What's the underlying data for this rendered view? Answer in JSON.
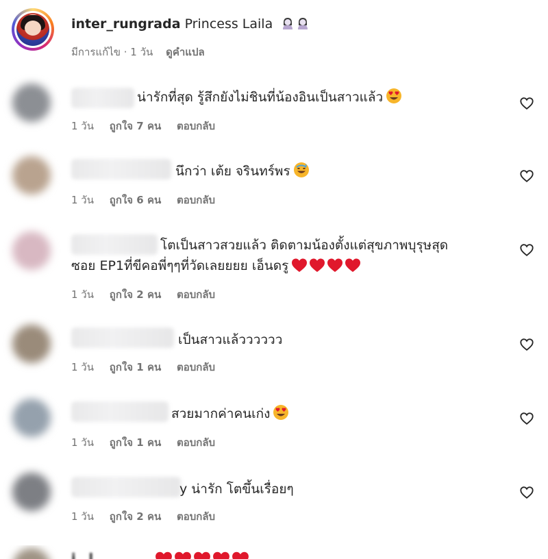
{
  "post": {
    "username": "inter_rungrada",
    "caption": "Princess Laila",
    "caption_emoji": [
      "woman-icon",
      "woman-icon"
    ],
    "meta_edited": "มีการแก้ไข · 1 วัน",
    "see_translation": "ดูคำแปล"
  },
  "comments": [
    {
      "text": "น่ารักที่สุด รู้สึกยังไม่ชินที่น้องอินเป็นสาวแล้ว",
      "emoji": [
        "heart-eyes-emoji"
      ],
      "time": "1 วัน",
      "likes": "ถูกใจ 7 คน",
      "reply": "ตอบกลับ",
      "avatar_color": "#8c8f94"
    },
    {
      "text": "นึกว่า เต้ย จรินทร์พร",
      "emoji": [
        "sweat-smile-emoji"
      ],
      "time": "1 วัน",
      "likes": "ถูกใจ 6 คน",
      "reply": "ตอบกลับ",
      "avatar_color": "#b9a38f"
    },
    {
      "text": "โตเป็นสาวสวยแล้ว ติดตามน้องตั้งแต่สุขภาพบุรุษสุด",
      "text2": "ซอย EP1ที่ขีคอพี่ๆๆที่วัดเลยยยย เอ็นดรู",
      "emoji": [
        "red-heart-emoji",
        "red-heart-emoji",
        "red-heart-emoji",
        "red-heart-emoji"
      ],
      "time": "1 วัน",
      "likes": "ถูกใจ 2 คน",
      "reply": "ตอบกลับ",
      "avatar_color": "#d8b8c2"
    },
    {
      "text": "เป็นสาวแล้วววววว",
      "emoji": [],
      "time": "1 วัน",
      "likes": "ถูกใจ 1 คน",
      "reply": "ตอบกลับ",
      "avatar_color": "#9a8b7a"
    },
    {
      "text": "สวยมากค่าคนเก่ง",
      "emoji": [
        "heart-eyes-emoji"
      ],
      "time": "1 วัน",
      "likes": "ถูกใจ 1 คน",
      "reply": "ตอบกลับ",
      "avatar_color": "#95a1ad"
    },
    {
      "text": "y น่ารัก โตขึ้นเรื่อยๆ",
      "emoji": [],
      "time": "1 วัน",
      "likes": "ถูกใจ 2 คน",
      "reply": "ตอบกลับ",
      "avatar_color": "#7d7f84"
    }
  ],
  "partial_comment": {
    "username": "i__l",
    "emoji": [
      "red-heart-emoji",
      "red-heart-emoji",
      "red-heart-emoji",
      "red-heart-emoji",
      "red-heart-emoji"
    ]
  },
  "colors": {
    "text": "#262626",
    "meta": "#737373",
    "heart_emoji": "#e0182c",
    "face_emoji": "#f7b52a"
  }
}
